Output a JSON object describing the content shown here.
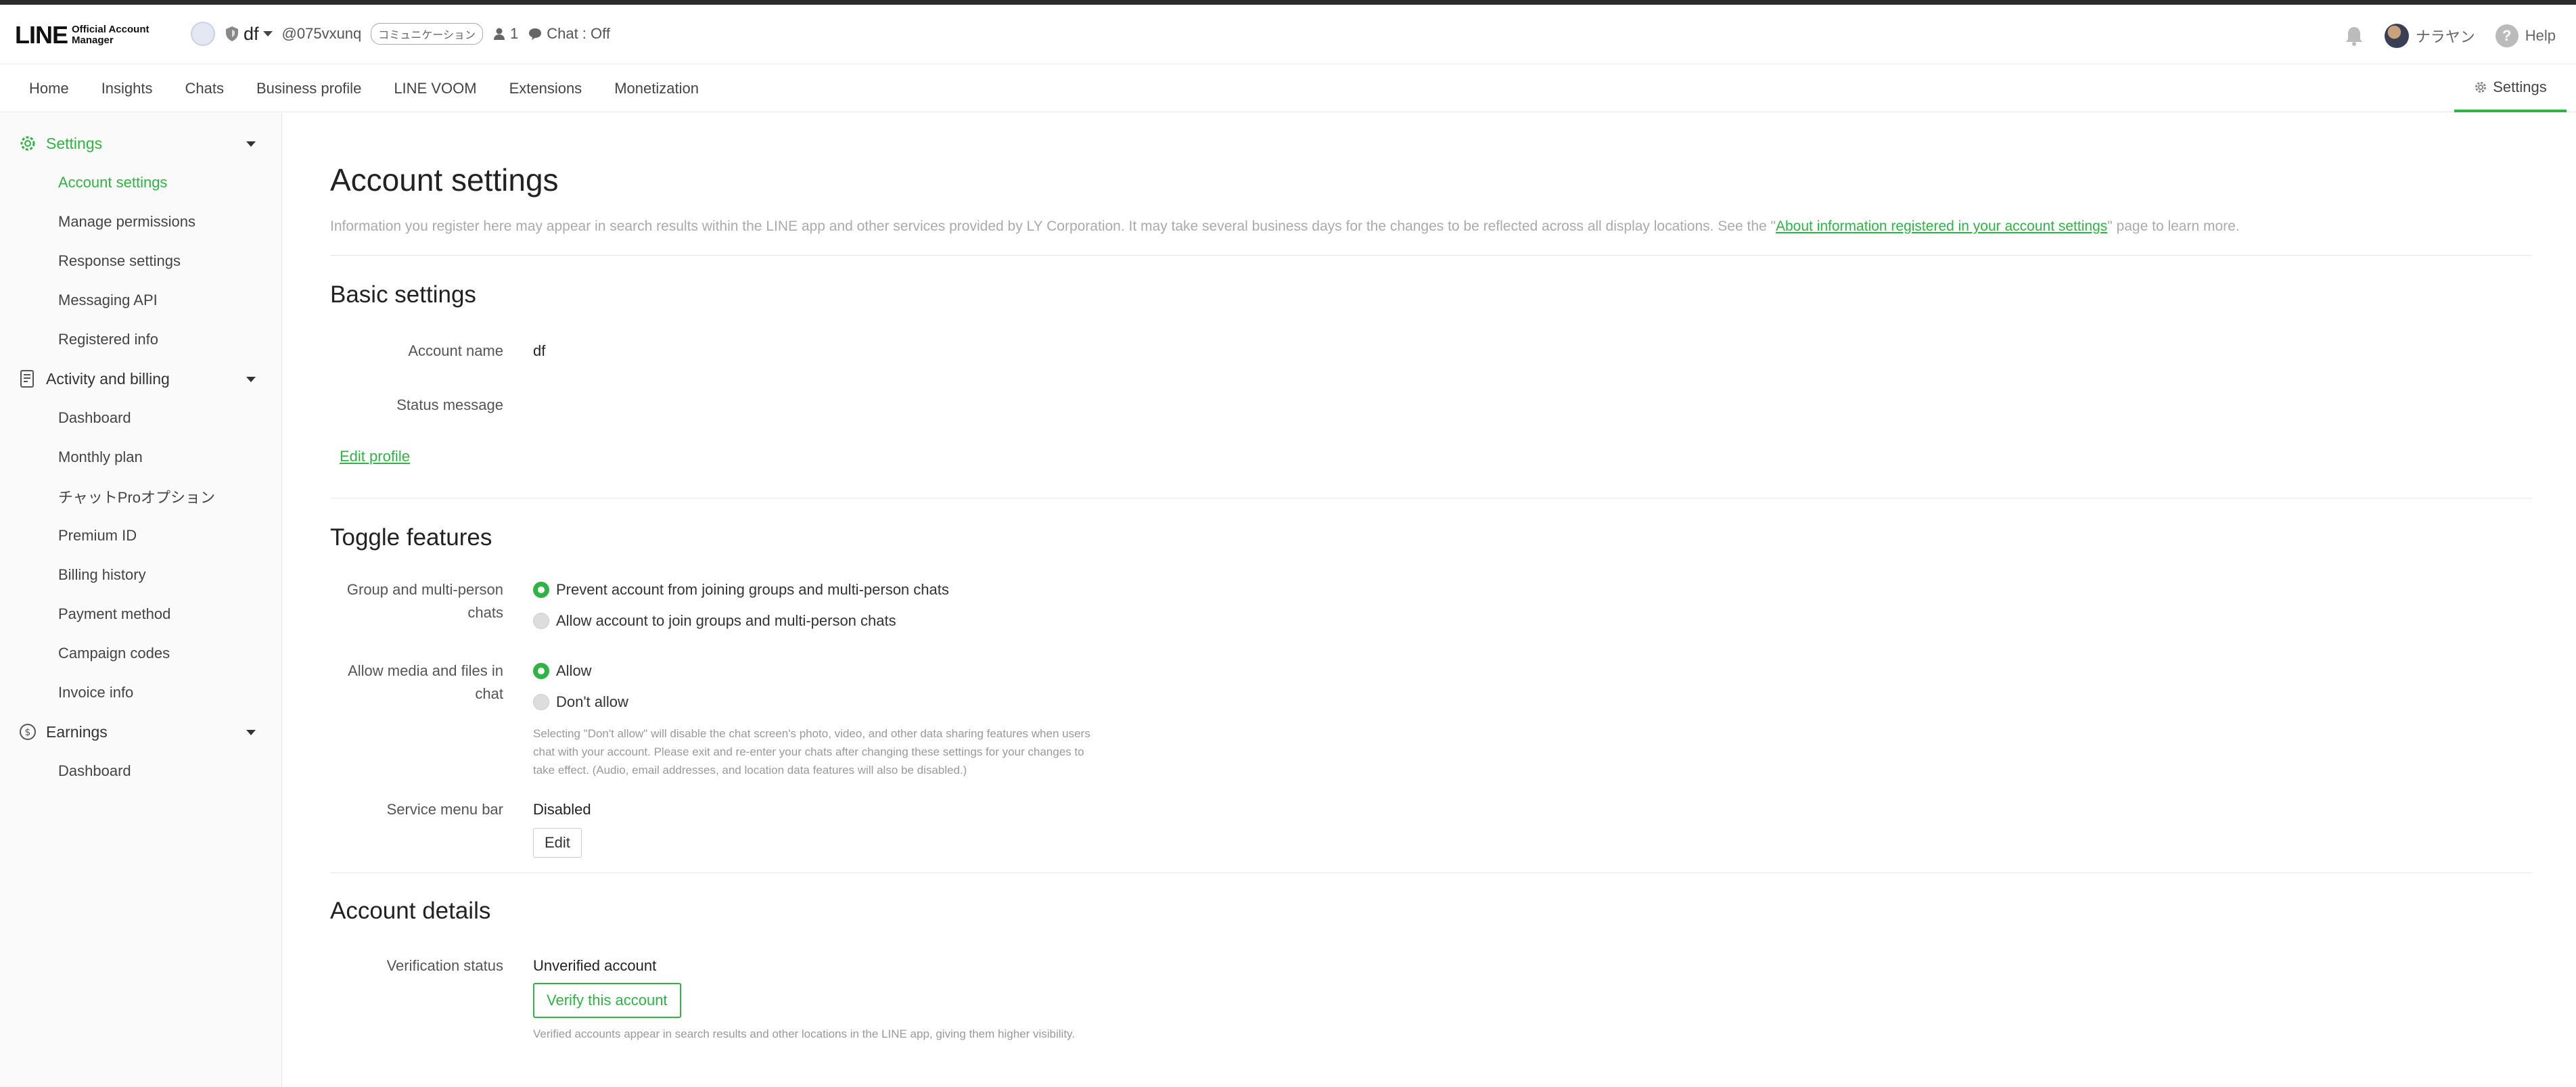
{
  "header": {
    "logo_main": "LINE",
    "logo_sub_1": "Official Account",
    "logo_sub_2": "Manager",
    "account_name": "df",
    "account_id": "@075vxunq",
    "account_badge": "コミュニケーション",
    "followers": "1",
    "chat_status": "Chat : Off",
    "user_name": "ナラヤン",
    "help_label": "Help",
    "help_icon_text": "?"
  },
  "nav": {
    "tabs": [
      "Home",
      "Insights",
      "Chats",
      "Business profile",
      "LINE VOOM",
      "Extensions",
      "Monetization"
    ],
    "settings_label": "Settings"
  },
  "sidebar": {
    "settings_label": "Settings",
    "settings_items": [
      "Account settings",
      "Manage permissions",
      "Response settings",
      "Messaging API",
      "Registered info"
    ],
    "activity_label": "Activity and billing",
    "activity_items": [
      "Dashboard",
      "Monthly plan",
      "チャットProオプション",
      "Premium ID",
      "Billing history",
      "Payment method",
      "Campaign codes",
      "Invoice info"
    ],
    "earnings_label": "Earnings",
    "earnings_items": [
      "Dashboard"
    ]
  },
  "main": {
    "title": "Account settings",
    "desc_prefix": "Information you register here may appear in search results within the LINE app and other services provided by LY Corporation. It may take several business days for the changes to be reflected across all display locations. See the \"",
    "desc_link": "About information registered in your account settings",
    "desc_suffix": "\" page to learn more.",
    "basic": {
      "title": "Basic settings",
      "account_name_label": "Account name",
      "account_name_value": "df",
      "status_message_label": "Status message",
      "status_message_value": "",
      "edit_profile": "Edit profile"
    },
    "toggle": {
      "title": "Toggle features",
      "group_label_1": "Group and multi-person",
      "group_label_2": "chats",
      "group_opt_1": "Prevent account from joining groups and multi-person chats",
      "group_opt_2": "Allow account to join groups and multi-person chats",
      "media_label_1": "Allow media and files in",
      "media_label_2": "chat",
      "media_opt_1": "Allow",
      "media_opt_2": "Don't allow",
      "media_note": "Selecting \"Don't allow\" will disable the chat screen's photo, video, and other data sharing features when users chat with your account. Please exit and re-enter your chats after changing these settings for your changes to take effect. (Audio, email addresses, and location data features will also be disabled.)",
      "service_menu_label": "Service menu bar",
      "service_menu_value": "Disabled",
      "edit_button": "Edit"
    },
    "details": {
      "title": "Account details",
      "verification_label": "Verification status",
      "verification_value": "Unverified account",
      "verify_button": "Verify this account",
      "verify_note": "Verified accounts appear in search results and other locations in the LINE app, giving them higher visibility."
    }
  },
  "colors": {
    "accent": "#2fb344",
    "topbar": "#2b2b2b",
    "sidebar_bg": "#fafafa"
  }
}
